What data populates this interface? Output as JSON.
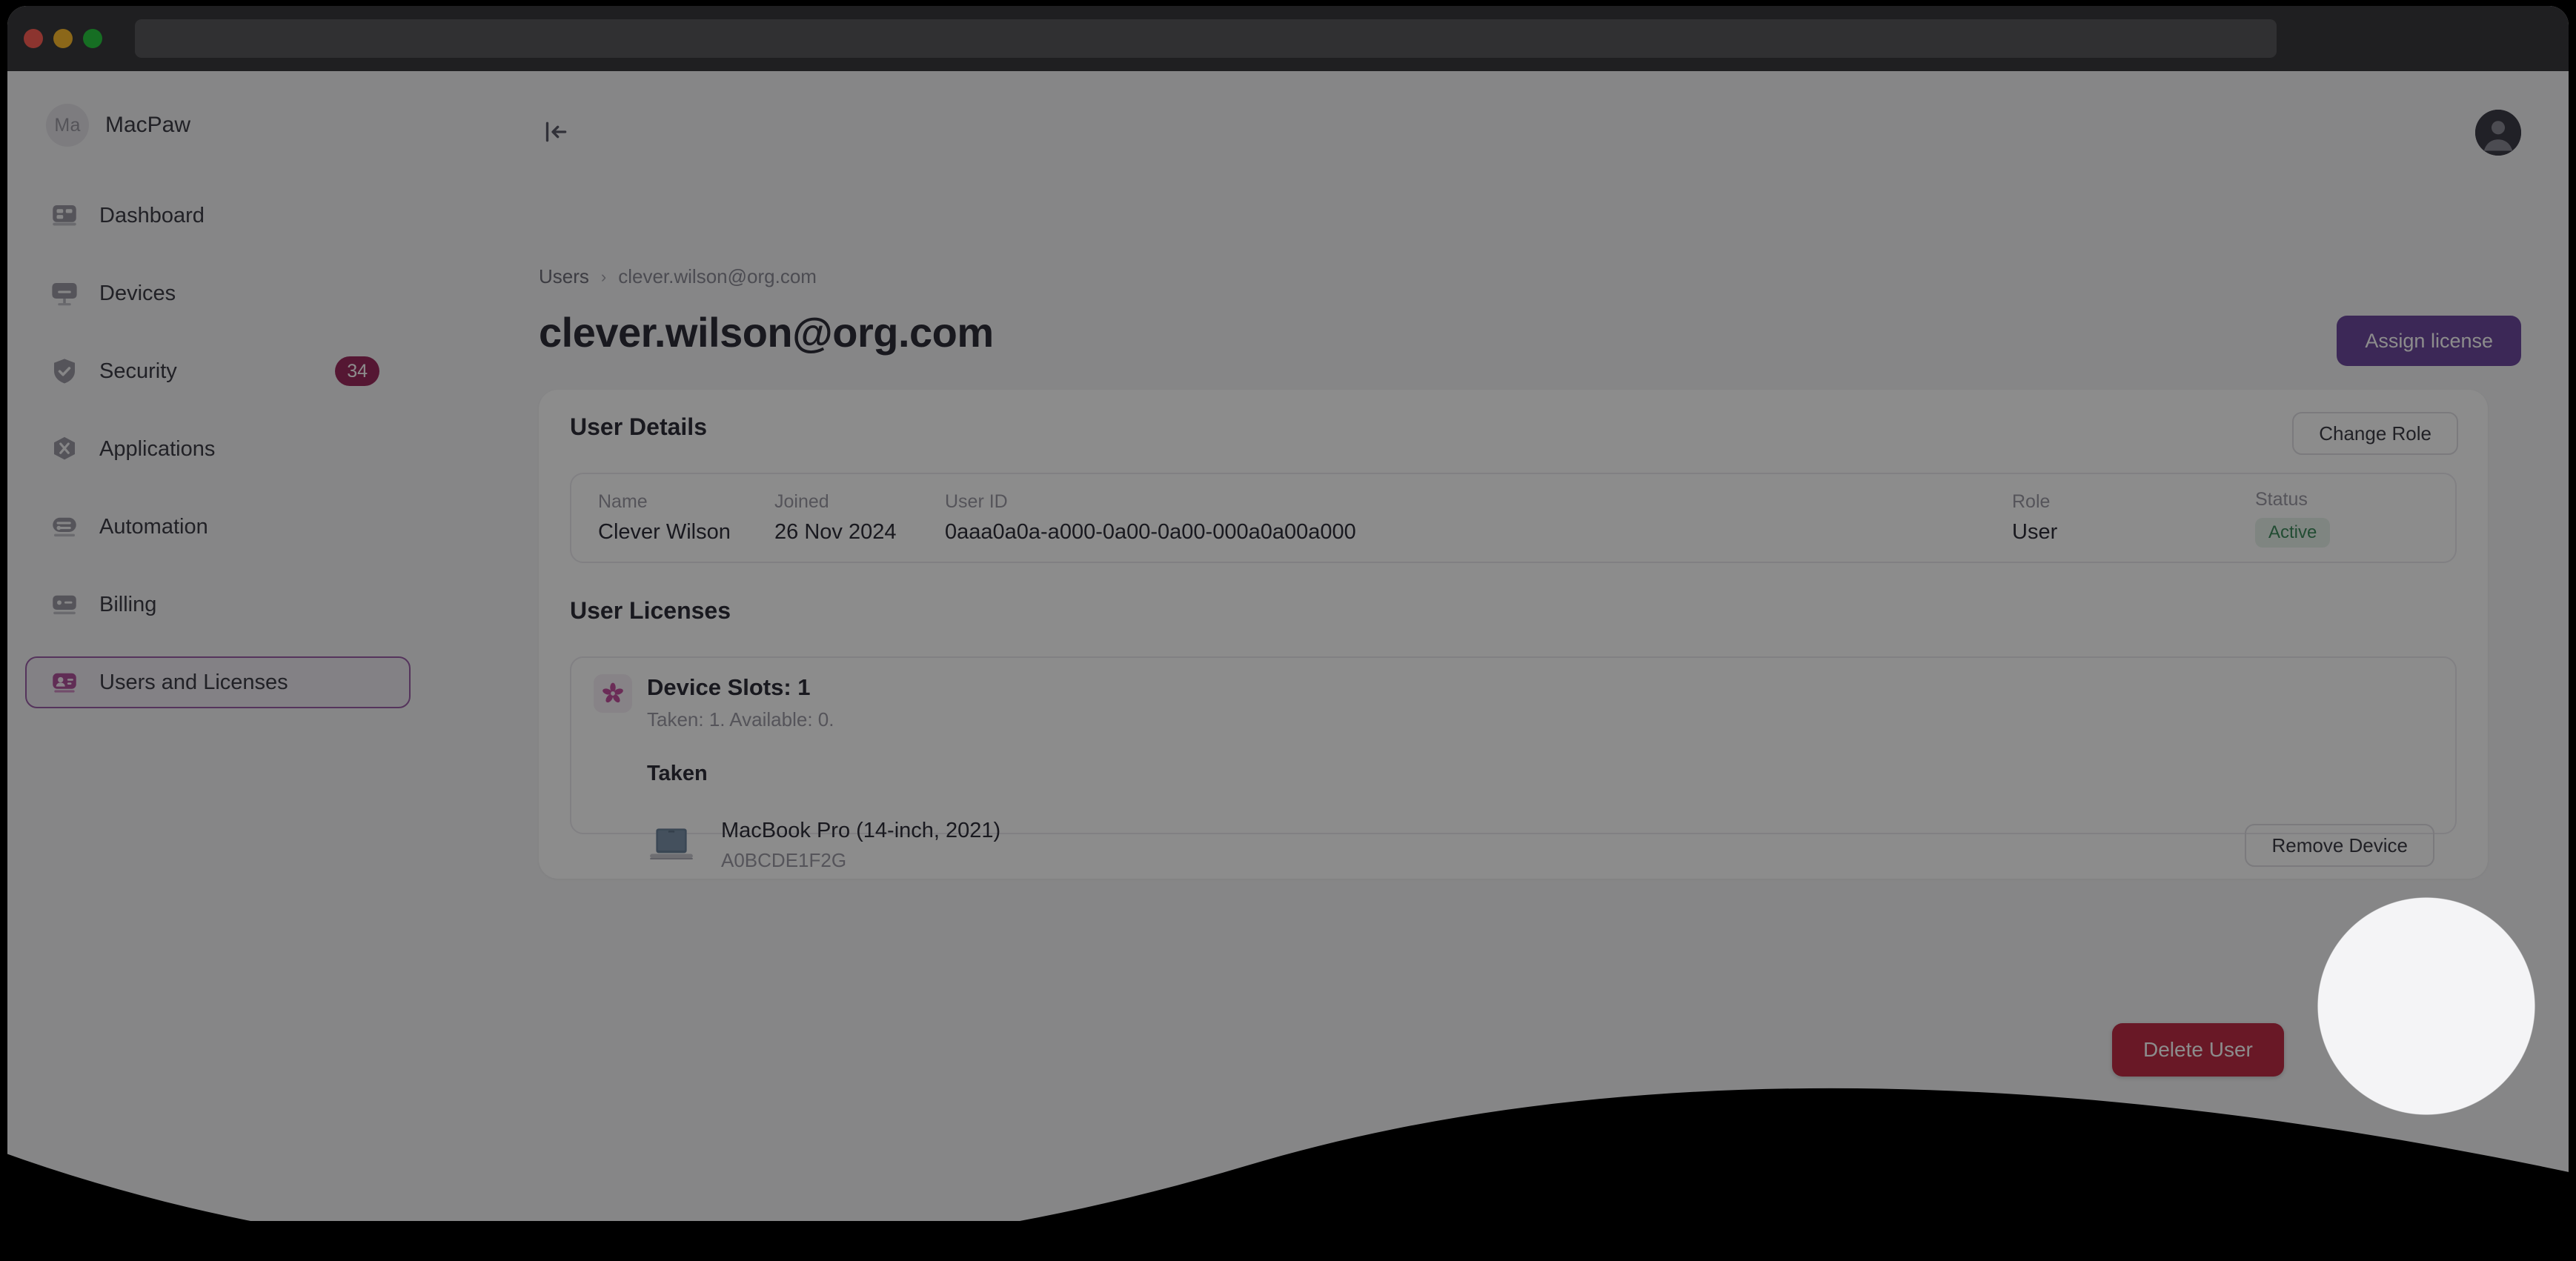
{
  "window": {
    "traffic_lights": [
      "close-button",
      "minimize-button",
      "maximize-button"
    ],
    "address_bar_value": ""
  },
  "sidebar": {
    "org": {
      "initials": "Ma",
      "name": "MacPaw"
    },
    "items": [
      {
        "label": "Dashboard",
        "icon": "dashboard-icon",
        "badge": "",
        "selected": false
      },
      {
        "label": "Devices",
        "icon": "monitor-icon",
        "badge": "",
        "selected": false
      },
      {
        "label": "Security",
        "icon": "shield-icon",
        "badge": "34",
        "selected": false
      },
      {
        "label": "Applications",
        "icon": "apps-icon",
        "badge": "",
        "selected": false
      },
      {
        "label": "Automation",
        "icon": "sliders-icon",
        "badge": "",
        "selected": false
      },
      {
        "label": "Billing",
        "icon": "card-icon",
        "badge": "",
        "selected": false
      },
      {
        "label": "Users and Licenses",
        "icon": "id-card-icon",
        "badge": "",
        "selected": true
      }
    ]
  },
  "topbar": {
    "collapse_icon": "collapse-sidebar-icon",
    "avatar_icon": "user-avatar-icon"
  },
  "breadcrumb": {
    "root": "Users",
    "separator": "›",
    "current": "clever.wilson@org.com"
  },
  "header": {
    "title": "clever.wilson@org.com",
    "assign_license_label": "Assign license"
  },
  "user_details": {
    "section_title": "User Details",
    "change_role_label": "Change Role",
    "fields": [
      {
        "label": "Name",
        "value": "Clever Wilson"
      },
      {
        "label": "Joined",
        "value": "26 Nov 2024"
      },
      {
        "label": "User ID",
        "value": "0aaa0a0a-a000-0a00-0a00-000a0a00a000"
      },
      {
        "label": "Role",
        "value": "User"
      },
      {
        "label": "Status",
        "value": "Active"
      }
    ]
  },
  "user_licenses": {
    "section_title": "User Licenses",
    "license": {
      "icon": "license-pinwheel-icon",
      "title": "Device Slots: 1",
      "subtitle": "Taken: 1. Available: 0.",
      "taken_label": "Taken",
      "devices": [
        {
          "icon": "laptop-icon",
          "name": "MacBook Pro (14-inch, 2021)",
          "serial": "A0BCDE1F2G",
          "remove_label": "Remove Device"
        }
      ]
    }
  },
  "danger_zone": {
    "delete_user_label": "Delete User"
  },
  "colors": {
    "accent_purple": "#6e4a9e",
    "selected_border": "#9b5fa8",
    "badge_pink": "#9c2b5e",
    "danger_red": "#bf2c45",
    "status_green_text": "#3f8a5d",
    "status_green_bg": "#e8f3ec",
    "page_bg": "#f4f4f6",
    "card_bg": "#ffffff"
  }
}
